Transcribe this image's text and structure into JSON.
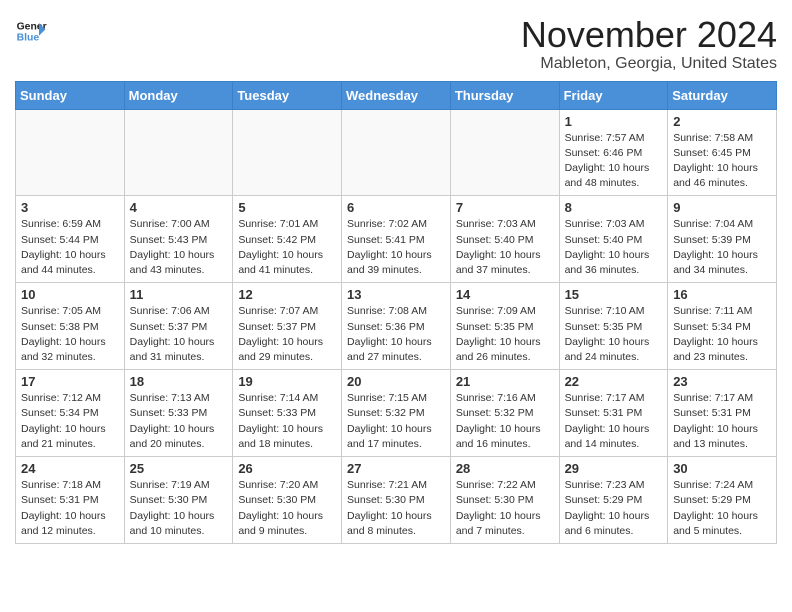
{
  "header": {
    "logo_line1": "General",
    "logo_line2": "Blue",
    "month": "November 2024",
    "location": "Mableton, Georgia, United States"
  },
  "weekdays": [
    "Sunday",
    "Monday",
    "Tuesday",
    "Wednesday",
    "Thursday",
    "Friday",
    "Saturday"
  ],
  "weeks": [
    [
      {
        "day": "",
        "info": ""
      },
      {
        "day": "",
        "info": ""
      },
      {
        "day": "",
        "info": ""
      },
      {
        "day": "",
        "info": ""
      },
      {
        "day": "",
        "info": ""
      },
      {
        "day": "1",
        "info": "Sunrise: 7:57 AM\nSunset: 6:46 PM\nDaylight: 10 hours\nand 48 minutes."
      },
      {
        "day": "2",
        "info": "Sunrise: 7:58 AM\nSunset: 6:45 PM\nDaylight: 10 hours\nand 46 minutes."
      }
    ],
    [
      {
        "day": "3",
        "info": "Sunrise: 6:59 AM\nSunset: 5:44 PM\nDaylight: 10 hours\nand 44 minutes."
      },
      {
        "day": "4",
        "info": "Sunrise: 7:00 AM\nSunset: 5:43 PM\nDaylight: 10 hours\nand 43 minutes."
      },
      {
        "day": "5",
        "info": "Sunrise: 7:01 AM\nSunset: 5:42 PM\nDaylight: 10 hours\nand 41 minutes."
      },
      {
        "day": "6",
        "info": "Sunrise: 7:02 AM\nSunset: 5:41 PM\nDaylight: 10 hours\nand 39 minutes."
      },
      {
        "day": "7",
        "info": "Sunrise: 7:03 AM\nSunset: 5:40 PM\nDaylight: 10 hours\nand 37 minutes."
      },
      {
        "day": "8",
        "info": "Sunrise: 7:03 AM\nSunset: 5:40 PM\nDaylight: 10 hours\nand 36 minutes."
      },
      {
        "day": "9",
        "info": "Sunrise: 7:04 AM\nSunset: 5:39 PM\nDaylight: 10 hours\nand 34 minutes."
      }
    ],
    [
      {
        "day": "10",
        "info": "Sunrise: 7:05 AM\nSunset: 5:38 PM\nDaylight: 10 hours\nand 32 minutes."
      },
      {
        "day": "11",
        "info": "Sunrise: 7:06 AM\nSunset: 5:37 PM\nDaylight: 10 hours\nand 31 minutes."
      },
      {
        "day": "12",
        "info": "Sunrise: 7:07 AM\nSunset: 5:37 PM\nDaylight: 10 hours\nand 29 minutes."
      },
      {
        "day": "13",
        "info": "Sunrise: 7:08 AM\nSunset: 5:36 PM\nDaylight: 10 hours\nand 27 minutes."
      },
      {
        "day": "14",
        "info": "Sunrise: 7:09 AM\nSunset: 5:35 PM\nDaylight: 10 hours\nand 26 minutes."
      },
      {
        "day": "15",
        "info": "Sunrise: 7:10 AM\nSunset: 5:35 PM\nDaylight: 10 hours\nand 24 minutes."
      },
      {
        "day": "16",
        "info": "Sunrise: 7:11 AM\nSunset: 5:34 PM\nDaylight: 10 hours\nand 23 minutes."
      }
    ],
    [
      {
        "day": "17",
        "info": "Sunrise: 7:12 AM\nSunset: 5:34 PM\nDaylight: 10 hours\nand 21 minutes."
      },
      {
        "day": "18",
        "info": "Sunrise: 7:13 AM\nSunset: 5:33 PM\nDaylight: 10 hours\nand 20 minutes."
      },
      {
        "day": "19",
        "info": "Sunrise: 7:14 AM\nSunset: 5:33 PM\nDaylight: 10 hours\nand 18 minutes."
      },
      {
        "day": "20",
        "info": "Sunrise: 7:15 AM\nSunset: 5:32 PM\nDaylight: 10 hours\nand 17 minutes."
      },
      {
        "day": "21",
        "info": "Sunrise: 7:16 AM\nSunset: 5:32 PM\nDaylight: 10 hours\nand 16 minutes."
      },
      {
        "day": "22",
        "info": "Sunrise: 7:17 AM\nSunset: 5:31 PM\nDaylight: 10 hours\nand 14 minutes."
      },
      {
        "day": "23",
        "info": "Sunrise: 7:17 AM\nSunset: 5:31 PM\nDaylight: 10 hours\nand 13 minutes."
      }
    ],
    [
      {
        "day": "24",
        "info": "Sunrise: 7:18 AM\nSunset: 5:31 PM\nDaylight: 10 hours\nand 12 minutes."
      },
      {
        "day": "25",
        "info": "Sunrise: 7:19 AM\nSunset: 5:30 PM\nDaylight: 10 hours\nand 10 minutes."
      },
      {
        "day": "26",
        "info": "Sunrise: 7:20 AM\nSunset: 5:30 PM\nDaylight: 10 hours\nand 9 minutes."
      },
      {
        "day": "27",
        "info": "Sunrise: 7:21 AM\nSunset: 5:30 PM\nDaylight: 10 hours\nand 8 minutes."
      },
      {
        "day": "28",
        "info": "Sunrise: 7:22 AM\nSunset: 5:30 PM\nDaylight: 10 hours\nand 7 minutes."
      },
      {
        "day": "29",
        "info": "Sunrise: 7:23 AM\nSunset: 5:29 PM\nDaylight: 10 hours\nand 6 minutes."
      },
      {
        "day": "30",
        "info": "Sunrise: 7:24 AM\nSunset: 5:29 PM\nDaylight: 10 hours\nand 5 minutes."
      }
    ]
  ]
}
